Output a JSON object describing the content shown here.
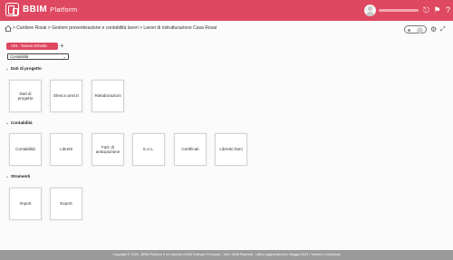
{
  "header": {
    "logo_text": "BBIM",
    "logo_sub": "Platform",
    "icons": [
      "logout-icon",
      "flag-icon",
      "help-icon"
    ],
    "accent": "#de4860"
  },
  "breadcrumb": {
    "path": "> Cantiere Rosai > Gestore preventivazione e contabilità lavori > Lavori di ristrutturazione Casa Rosai"
  },
  "tab": {
    "label": "A01 - Nuova Scheda",
    "add": "+"
  },
  "select": {
    "value": "Contabilità"
  },
  "sections": [
    {
      "title": "Dati di progetto",
      "cards": [
        "Dati di progetto",
        "Elenco prezzi",
        "Rielaborazioni"
      ]
    },
    {
      "title": "Contabilità",
      "cards": [
        "Contabilità",
        "Libretti",
        "Fatt. di anticipazione",
        "S.A.L.",
        "Certificati",
        "Libretto fami"
      ]
    },
    {
      "title": "Strumenti",
      "cards": [
        "Import",
        "Export"
      ]
    }
  ],
  "footer": {
    "text": "Copyright © 2020 - BBIM Platform è un marchio di BIM Software Protocols - Tutti i Diritti Riservati - Ultimo aggiornamento: Maggio 2020 | Termini e Condizioni"
  }
}
